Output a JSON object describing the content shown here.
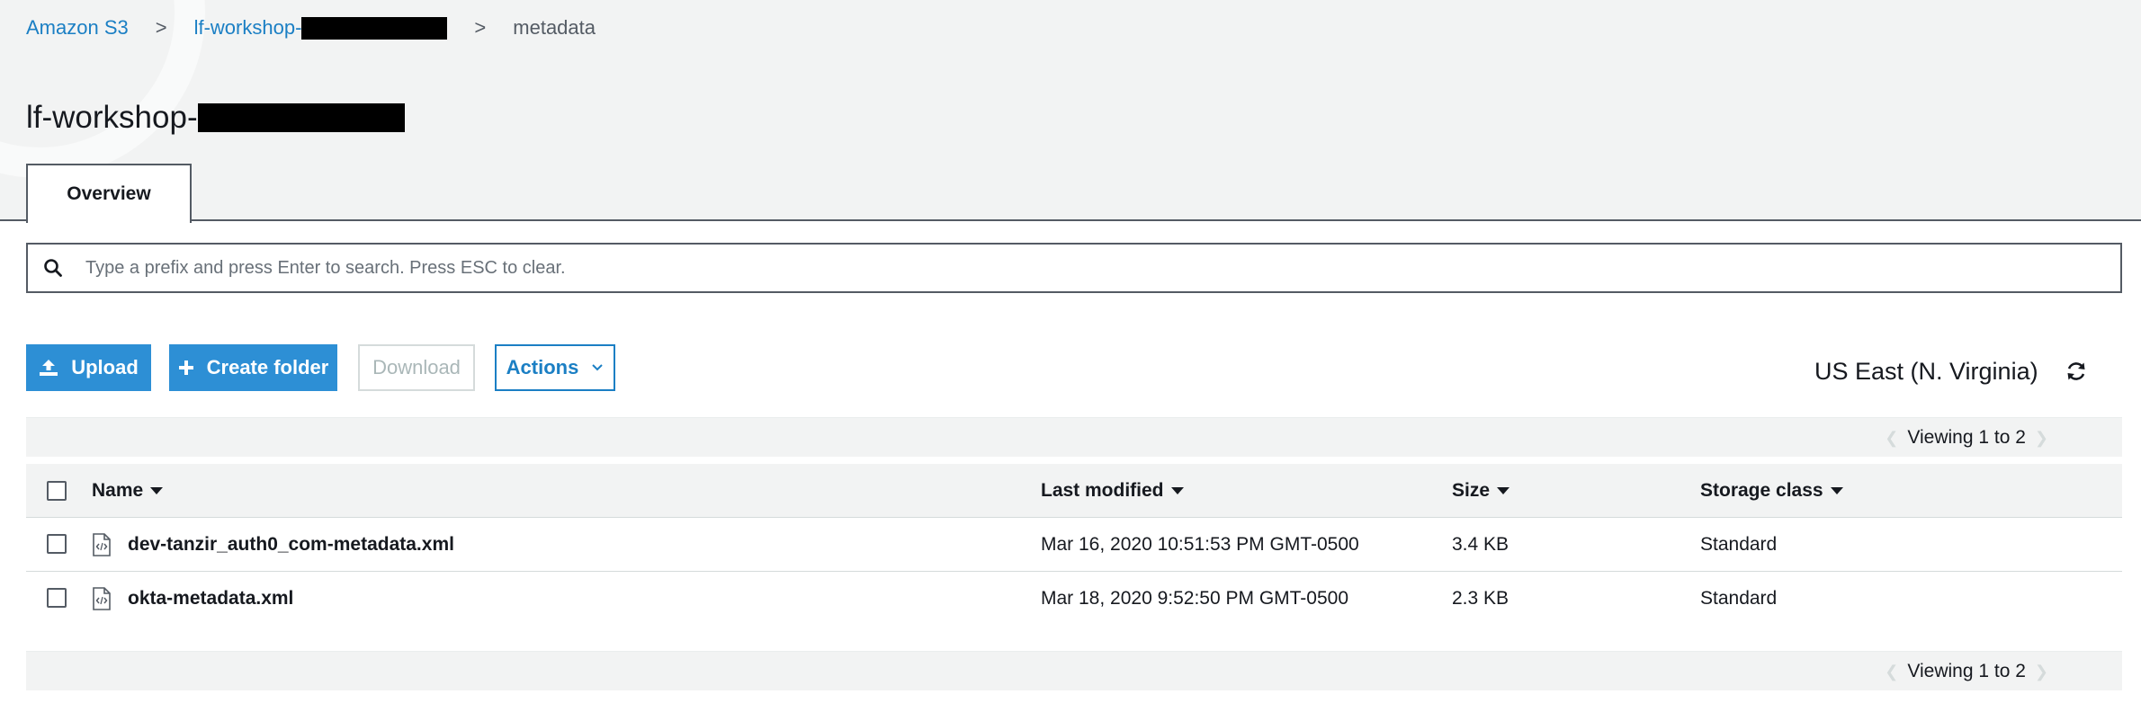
{
  "breadcrumb": {
    "root": "Amazon S3",
    "bucket_prefix": "lf-workshop-",
    "current": "metadata",
    "separator": ">"
  },
  "page": {
    "title_prefix": "lf-workshop-"
  },
  "tabs": [
    {
      "label": "Overview",
      "active": true
    }
  ],
  "search": {
    "placeholder": "Type a prefix and press Enter to search. Press ESC to clear.",
    "value": ""
  },
  "toolbar": {
    "upload_label": "Upload",
    "create_folder_label": "Create folder",
    "download_label": "Download",
    "actions_label": "Actions"
  },
  "region": "US East (N. Virginia)",
  "pagination": {
    "viewing_label": "Viewing 1 to 2"
  },
  "table": {
    "columns": [
      "Name",
      "Last modified",
      "Size",
      "Storage class"
    ],
    "rows": [
      {
        "name": "dev-tanzir_auth0_com-metadata.xml",
        "last_modified": "Mar 16, 2020 10:51:53 PM GMT-0500",
        "size": "3.4 KB",
        "storage_class": "Standard"
      },
      {
        "name": "okta-metadata.xml",
        "last_modified": "Mar 18, 2020 9:52:50 PM GMT-0500",
        "size": "2.3 KB",
        "storage_class": "Standard"
      }
    ]
  },
  "colors": {
    "link": "#1b7fc4",
    "primary_button": "#2d8fd5",
    "header_bg": "#f2f3f3",
    "border_dark": "#545b64"
  },
  "icons": {
    "search": "search-icon",
    "upload": "upload-icon",
    "create_folder": "plus-icon",
    "actions": "chevron-down-icon",
    "refresh": "refresh-icon",
    "file": "xml-file-icon",
    "sort": "sort-caret-icon"
  }
}
